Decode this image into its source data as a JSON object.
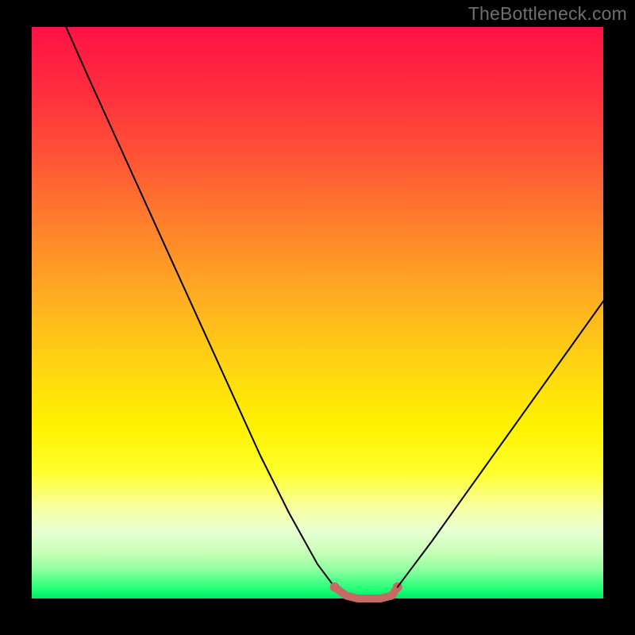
{
  "attribution": "TheBottleneck.com",
  "chart_data": {
    "type": "line",
    "title": "",
    "xlabel": "",
    "ylabel": "",
    "xlim": [
      0,
      100
    ],
    "ylim": [
      0,
      100
    ],
    "grid": false,
    "legend": false,
    "description": "Bottleneck V-curve: y represents bottleneck magnitude (0 = balanced, high = severe mismatch) against a component performance axis. Left branch descends steeply from near 100 at x≈6 to a flat minimum; right branch rises less steeply. Flat minimum segment is highlighted.",
    "series": [
      {
        "name": "left-branch",
        "color": "#000000",
        "x": [
          6,
          10,
          15,
          20,
          25,
          30,
          35,
          40,
          45,
          50,
          53
        ],
        "values": [
          100,
          91,
          80,
          69,
          58,
          47,
          36,
          25,
          15,
          6,
          2
        ]
      },
      {
        "name": "minimum-flat",
        "color": "#c66a66",
        "x": [
          53,
          55,
          57,
          59,
          61,
          63,
          64
        ],
        "values": [
          2,
          0.5,
          0,
          0,
          0,
          0.5,
          2
        ]
      },
      {
        "name": "right-branch",
        "color": "#000000",
        "x": [
          64,
          70,
          75,
          80,
          85,
          90,
          95,
          100
        ],
        "values": [
          2,
          10,
          17,
          24,
          31,
          38,
          45,
          52
        ]
      }
    ],
    "annotations": []
  }
}
